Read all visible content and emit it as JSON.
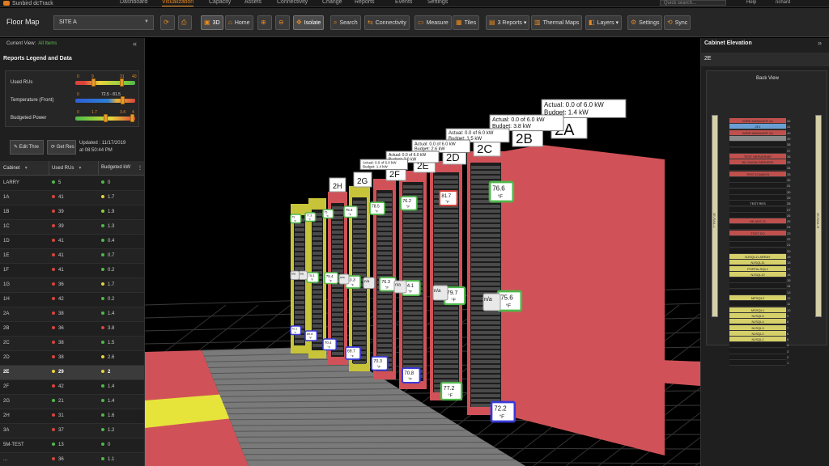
{
  "topnav": {
    "brand": "Sunbird dcTrack",
    "tabs": [
      "Dashboard",
      "Visualization",
      "Capacity",
      "Assets",
      "Connectivity",
      "Change",
      "Reports",
      "Events",
      "Settings"
    ],
    "active_tab": "Visualization",
    "search_placeholder": "Quick search...",
    "help": "Help",
    "user": "richard",
    "accent_color": "#e8891f"
  },
  "toolbar": {
    "title": "Floor Map",
    "site": "SITE A",
    "buttons": [
      {
        "name": "refresh-button",
        "label": "",
        "icon": "refresh-icon"
      },
      {
        "name": "print-button",
        "label": "",
        "icon": "print-icon"
      },
      {
        "name": "3d-button",
        "label": "3D",
        "icon": "cube-icon"
      },
      {
        "name": "home-button",
        "label": "Home",
        "icon": "home-icon"
      },
      {
        "name": "zoom-in-button",
        "label": "",
        "icon": "zoom-in-icon"
      },
      {
        "name": "zoom-out-button",
        "label": "",
        "icon": "zoom-out-icon"
      },
      {
        "name": "isolate-button",
        "label": "Isolate",
        "icon": "isolate-icon"
      },
      {
        "name": "search-button",
        "label": "Search",
        "icon": "search-icon"
      },
      {
        "name": "connectivity-button",
        "label": "Connectivity",
        "icon": "connectivity-icon"
      },
      {
        "name": "measure-button",
        "label": "Measure",
        "icon": "measure-icon"
      },
      {
        "name": "tiles-button",
        "label": "Tiles",
        "icon": "tiles-icon"
      },
      {
        "name": "reports-button",
        "label": "3 Reports ▾",
        "icon": "reports-icon"
      },
      {
        "name": "thermal-maps-button",
        "label": "Thermal Maps",
        "icon": "thermal-icon"
      },
      {
        "name": "layers-button",
        "label": "Layers ▾",
        "icon": "layers-icon"
      },
      {
        "name": "settings-button",
        "label": "Settings",
        "icon": "gear-icon"
      },
      {
        "name": "sync-button",
        "label": "Sync",
        "icon": "sync-icon"
      }
    ]
  },
  "left": {
    "current_view_label": "Current View:",
    "current_view_value": "All Items",
    "legend_title": "Reports Legend and Data",
    "legend": [
      {
        "label": "Used RUs",
        "ticks": [
          "0",
          "9",
          "31",
          "40"
        ],
        "gradient": "linear-gradient(90deg,#d9443a 0%,#d9443a 15%,#e8d23a 40%,#8ccf3f 80%,#4fb84a 100%)"
      },
      {
        "label": "Temperature (Front)",
        "ticks": [
          "0",
          "72.5 - 81.5",
          "",
          ""
        ],
        "gradient": "linear-gradient(90deg,#2d5fd6 0%,#2d7fd6 55%,#e8b23a 70%,#d9443a 100%)"
      },
      {
        "label": "Budgeted Power",
        "ticks": [
          "0",
          "1.7",
          "3.4",
          "4"
        ],
        "gradient": "linear-gradient(90deg,#4fb84a 0%,#8ccf3f 30%,#e8d23a 60%,#d9443a 100%)"
      }
    ],
    "edit_label": "Edit Thre",
    "get_label": "Get Res",
    "updated_label": "Updated : 11/17/2019",
    "updated_time": "at 08:50:44 PM",
    "columns": [
      "Cabinet",
      "Used RUs",
      "Budgeted kW"
    ],
    "rows": [
      {
        "name": "LARRY",
        "ru": "5",
        "rc": "#4fb84a",
        "kw": "0",
        "kc": "#4fb84a"
      },
      {
        "name": "1A",
        "ru": "41",
        "rc": "#d9443a",
        "kw": "1.7",
        "kc": "#e8d23a"
      },
      {
        "name": "1B",
        "ru": "39",
        "rc": "#d9443a",
        "kw": "1.9",
        "kc": "#8ccf3f"
      },
      {
        "name": "1C",
        "ru": "39",
        "rc": "#d9443a",
        "kw": "1.3",
        "kc": "#4fb84a"
      },
      {
        "name": "1D",
        "ru": "41",
        "rc": "#d9443a",
        "kw": "0.4",
        "kc": "#4fb84a"
      },
      {
        "name": "1E",
        "ru": "41",
        "rc": "#d9443a",
        "kw": "0.7",
        "kc": "#4fb84a"
      },
      {
        "name": "1F",
        "ru": "41",
        "rc": "#d9443a",
        "kw": "0.2",
        "kc": "#4fb84a"
      },
      {
        "name": "1G",
        "ru": "36",
        "rc": "#d9443a",
        "kw": "1.7",
        "kc": "#e8d23a"
      },
      {
        "name": "1H",
        "ru": "42",
        "rc": "#d9443a",
        "kw": "0.2",
        "kc": "#4fb84a"
      },
      {
        "name": "2A",
        "ru": "38",
        "rc": "#d9443a",
        "kw": "1.4",
        "kc": "#4fb84a"
      },
      {
        "name": "2B",
        "ru": "36",
        "rc": "#d9443a",
        "kw": "3.8",
        "kc": "#d9443a"
      },
      {
        "name": "2C",
        "ru": "38",
        "rc": "#d9443a",
        "kw": "1.5",
        "kc": "#4fb84a"
      },
      {
        "name": "2D",
        "ru": "38",
        "rc": "#d9443a",
        "kw": "2.6",
        "kc": "#e8d23a"
      },
      {
        "name": "2E",
        "ru": "29",
        "rc": "#e8d23a",
        "kw": "2",
        "kc": "#e8d23a"
      },
      {
        "name": "2F",
        "ru": "42",
        "rc": "#d9443a",
        "kw": "1.4",
        "kc": "#4fb84a"
      },
      {
        "name": "2G",
        "ru": "21",
        "rc": "#4fb84a",
        "kw": "1.4",
        "kc": "#4fb84a"
      },
      {
        "name": "2H",
        "ru": "31",
        "rc": "#d9443a",
        "kw": "1.6",
        "kc": "#4fb84a"
      },
      {
        "name": "3A",
        "ru": "37",
        "rc": "#d9443a",
        "kw": "1.2",
        "kc": "#4fb84a"
      },
      {
        "name": "5M-TEST",
        "ru": "13",
        "rc": "#4fb84a",
        "kw": "0",
        "kc": "#4fb84a"
      },
      {
        "name": "...",
        "ru": "36",
        "rc": "#d9443a",
        "kw": "1.1",
        "kc": "#4fb84a"
      }
    ],
    "selected": "2E"
  },
  "view": {
    "power_labels": [
      {
        "actual": "Actual: 0.0 of 6.0 kW",
        "budget": "Budget: 1.4 kW"
      },
      {
        "actual": "Actual: 0.0 of 6.0 kW",
        "budget": "Budget: 3.8 kW"
      },
      {
        "actual": "Actual: 0.0 of 6.0 kW",
        "budget": "Budget: 1.5 kW"
      },
      {
        "actual": "Actual: 0.0 of 6.0 kW",
        "budget": "Budget: 2.6 kW"
      },
      {
        "actual": "Actual: 0.0 of 6.0 kW",
        "budget": "Budget: 2.0 kW"
      },
      {
        "actual": "Actual: 0.0 of 6.0 kW",
        "budget": "Budget: 1.4 kW"
      }
    ],
    "cabinet_labels": [
      "2A",
      "2B",
      "2C",
      "2D",
      "2E",
      "2F",
      "2G",
      "2H"
    ],
    "temps_top": [
      {
        "v": "76.6",
        "c": "#4fb84a"
      },
      {
        "v": "81.7",
        "c": "#d9443a"
      },
      {
        "v": "76.2",
        "c": "#4fb84a"
      },
      {
        "v": "78.5",
        "c": "#4fb84a"
      },
      {
        "v": "75.4",
        "c": "#4fb84a"
      },
      {
        "v": "79",
        "c": "#4fb84a"
      },
      {
        "v": "77.3",
        "c": "#4fb84a"
      },
      {
        "v": "75",
        "c": "#4fb84a"
      }
    ],
    "temps_mid": [
      {
        "v": "75.6",
        "c": "#4fb84a"
      },
      {
        "v": "79.7",
        "c": "#4fb84a"
      },
      {
        "v": "74.1",
        "c": "#4fb84a"
      },
      {
        "v": "76.3",
        "c": "#4fb84a"
      },
      {
        "v": "73.3",
        "c": "#4fb84a"
      },
      {
        "v": "75.4",
        "c": "#4fb84a"
      },
      {
        "v": "75.3",
        "c": "#4fb84a"
      }
    ],
    "na_mid": [
      "n/a",
      "n/a",
      "n/a",
      "n/a",
      "n/a",
      "n/a",
      "n/a"
    ],
    "temps_bot": [
      {
        "v": "72.2",
        "c": "#3a3ad9"
      },
      {
        "v": "77.2",
        "c": "#4fb84a"
      },
      {
        "v": "70.8",
        "c": "#3a3ad9"
      },
      {
        "v": "70.3",
        "c": "#3a3ad9"
      },
      {
        "v": "69.7",
        "c": "#3a3ad9"
      },
      {
        "v": "70.4",
        "c": "#3a3ad9"
      },
      {
        "v": "69.8",
        "c": "#3a3ad9"
      },
      {
        "v": "70.1",
        "c": "#3a3ad9"
      }
    ],
    "unit": "°F",
    "rack_red": "#d05258",
    "rack_yellow": "#c8c43a",
    "floor_red": "#d05258"
  },
  "right": {
    "title": "Cabinet Elevation",
    "cabinet": "2E",
    "back_view": "Back View",
    "rail_label": "2E-RAIL-L",
    "rail_label_r": "2E-RAIL-R",
    "items": [
      {
        "u": 42,
        "label": "WIRE MANAGER 1U",
        "c": "#c0504d"
      },
      {
        "u": 41,
        "label": "2E1",
        "c": "#6a9fd4"
      },
      {
        "u": 40,
        "label": "WIRE MANAGER 1U",
        "c": "#c0504d"
      },
      {
        "u": 39,
        "label": "",
        "c": "#8a8a8a"
      },
      {
        "u": 36,
        "label": "TEST SERVER987",
        "c": "#c0504d"
      },
      {
        "u": 35,
        "label": "RK-SNOW-SERVER1",
        "c": "#c0504d"
      },
      {
        "u": 33,
        "label": "TEST12345678",
        "c": "#c0504d"
      },
      {
        "u": 28,
        "label": "TEST RES",
        "c": "#1a1a1a"
      },
      {
        "u": 25,
        "label": "HK ADS 21",
        "c": "#c0504d"
      },
      {
        "u": 23,
        "label": "TEST DO",
        "c": "#c0504d"
      },
      {
        "u": 19,
        "label": "NJSQL11 ARRAY",
        "c": "#d6d06a"
      },
      {
        "u": 18,
        "label": "NJSQL11",
        "c": "#d6d06a"
      },
      {
        "u": 17,
        "label": "PORTALSQL1",
        "c": "#d6d06a"
      },
      {
        "u": 16,
        "label": "NJSQL12",
        "c": "#d6d06a"
      },
      {
        "u": 12,
        "label": "MPSQL2",
        "c": "#d6d06a"
      },
      {
        "u": 10,
        "label": "MSSQL1",
        "c": "#d6d06a"
      },
      {
        "u": 9,
        "label": "NJSQL5",
        "c": "#d6d06a"
      },
      {
        "u": 8,
        "label": "NJSQL4",
        "c": "#d6d06a"
      },
      {
        "u": 7,
        "label": "NJSQL3",
        "c": "#d6d06a"
      },
      {
        "u": 6,
        "label": "NJSQL2",
        "c": "#d6d06a"
      },
      {
        "u": 5,
        "label": "NJSQL1",
        "c": "#d6d06a"
      }
    ]
  }
}
